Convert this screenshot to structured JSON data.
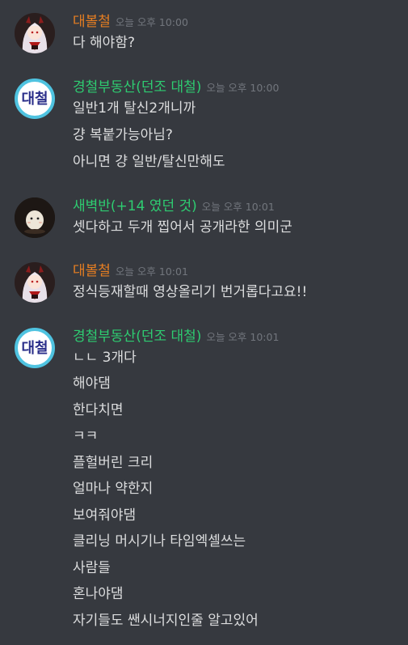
{
  "messages": [
    {
      "username": "대볼철",
      "name_color": "#e67e22",
      "timestamp": "오늘 오후 10:00",
      "lines": [
        "다 해야함?"
      ]
    },
    {
      "username": "경철부동산(던조 대철)",
      "name_color": "#2ecc71",
      "timestamp": "오늘 오후 10:00",
      "avatar_text": "대철",
      "lines": [
        "일반1개 탈신2개니까",
        "걍 복붙가능아님?",
        "아니면 걍 일반/탈신만해도"
      ]
    },
    {
      "username": "새벽반(+14 였던 것)",
      "name_color": "#2ecc71",
      "timestamp": "오늘 오후 10:01",
      "lines": [
        "셋다하고 두개 찝어서 공개라한 의미군"
      ]
    },
    {
      "username": "대볼철",
      "name_color": "#e67e22",
      "timestamp": "오늘 오후 10:01",
      "lines": [
        "정식등재할때 영상올리기 번거롭다고요!!"
      ]
    },
    {
      "username": "경철부동산(던조 대철)",
      "name_color": "#2ecc71",
      "timestamp": "오늘 오후 10:01",
      "avatar_text": "대철",
      "lines": [
        "ㄴㄴ 3개다",
        "해야댐",
        "한다치면",
        "ㅋㅋ",
        "플헐버린 크리",
        "얼마나 약한지",
        "보여줘야댐",
        "클리닝 머시기나 타임엑셀쓰는",
        "사람들",
        "혼나야댐",
        "자기들도 쌘시너지인줄 알고있어"
      ]
    }
  ]
}
